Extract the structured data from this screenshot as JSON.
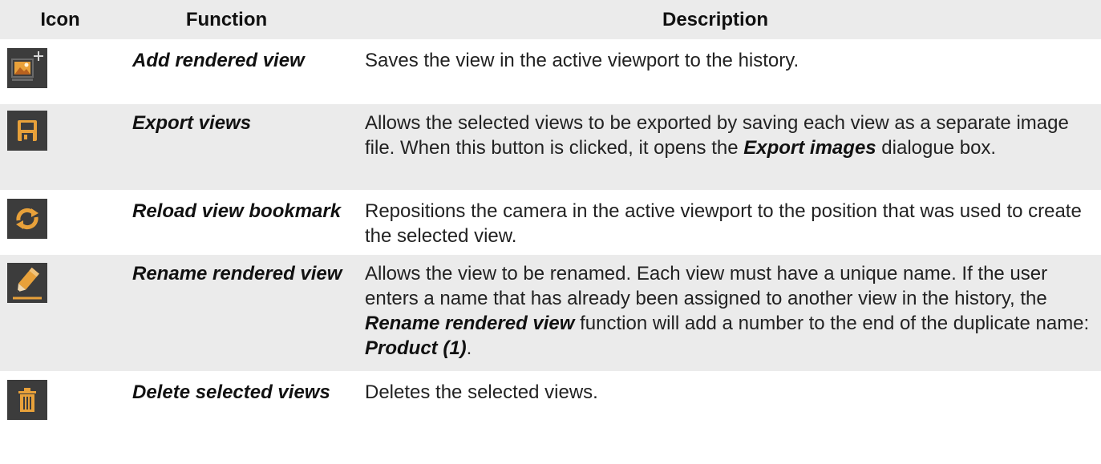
{
  "header": {
    "icon": "Icon",
    "function": "Function",
    "description": "Description"
  },
  "rows": [
    {
      "icon": "add-image-icon",
      "function": "Add rendered view",
      "description": [
        "Saves the view in the active viewport to the history."
      ]
    },
    {
      "icon": "floppy-disk-icon",
      "function": "Export views",
      "description": [
        "Allows the selected views to be exported by saving each view as a separate image file. When this button is clicked, it opens the ",
        "Export images",
        " dialogue box."
      ]
    },
    {
      "icon": "refresh-icon",
      "function": "Reload view bookmark",
      "description": [
        "Repositions the camera in the active viewport to the position that was used to create the selected view."
      ]
    },
    {
      "icon": "rename-pencil-icon",
      "function": "Rename rendered view",
      "description": [
        "Allows the view to be renamed. Each view must have a unique name. If the user enters a name that has already been assigned to another view in the history, the ",
        "Rename rendered view",
        " function will add a number to the end of the duplicate name: ",
        "Product (1)",
        "."
      ]
    },
    {
      "icon": "trash-icon",
      "function": "Delete selected views",
      "description": [
        "Deletes the selected views."
      ]
    }
  ],
  "colors": {
    "accent_orange": "#e8a13a",
    "icon_background": "#3c3c3c",
    "row_shade": "#ebebeb"
  }
}
